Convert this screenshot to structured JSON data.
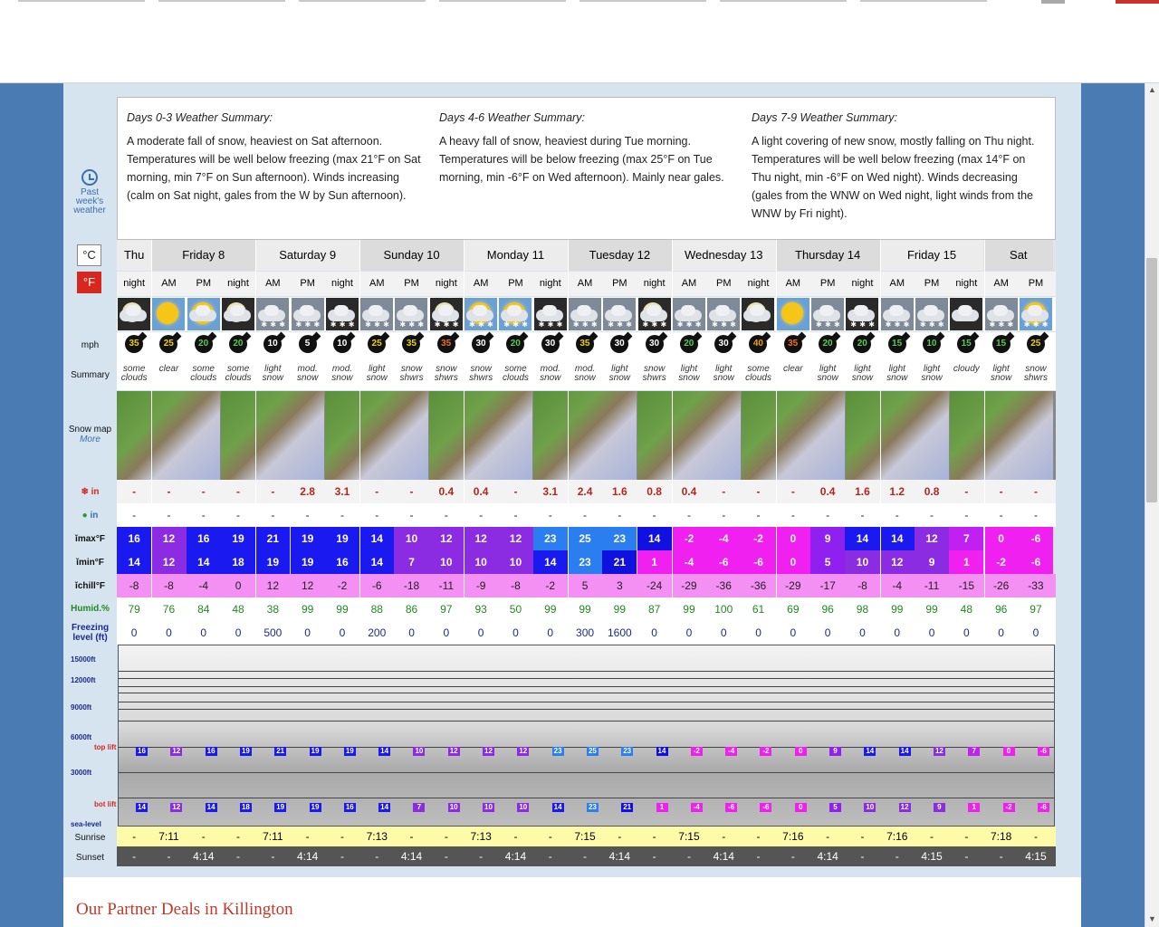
{
  "summary": [
    {
      "title": "Days 0-3 Weather Summary:",
      "text": "A moderate fall of snow, heaviest on Sat afternoon. Temperatures will be well below freezing (max 21°F on Sat morning, min 7°F on Sun afternoon). Winds increasing (calm on Sat night, gales from the W by Sun afternoon)."
    },
    {
      "title": "Days 4-6 Weather Summary:",
      "text": "A heavy fall of snow, heaviest during Tue morning. Temperatures will be below freezing (max 25°F on Tue morning, min -6°F on Wed afternoon). Mainly near gales."
    },
    {
      "title": "Days 7-9 Weather Summary:",
      "text": "A light covering of new snow, mostly falling on Thu night. Temperatures will be well below freezing (max 14°F on Thu night, min -6°F on Wed night). Winds decreasing (gales from the WNW on Wed night, light winds from the WNW by Fri night)."
    }
  ],
  "past_weather": "Past week's weather",
  "units": {
    "c": "°C",
    "f": "°F"
  },
  "labels": {
    "mph": "mph",
    "summary": "Summary",
    "snowmap": "Snow map",
    "more": "More",
    "snow": "in",
    "rain": "in",
    "max": "max°F",
    "min": "min°F",
    "chill": "chill°F",
    "humid": "Humid.%",
    "freezing": "Freezing level (ft)",
    "sunrise": "Sunrise",
    "sunset": "Sunset",
    "partner": "Our Partner Deals in Killington"
  },
  "height_labels": [
    "15000ft",
    "12000ft",
    "9000ft",
    "6000ft",
    "top lift",
    "3000ft",
    "bot lift",
    "sea-level"
  ],
  "days": [
    {
      "name": "Thu",
      "n": 1
    },
    {
      "name": "Friday 8",
      "n": 3
    },
    {
      "name": "Saturday 9",
      "n": 3
    },
    {
      "name": "Sunday 10",
      "n": 3
    },
    {
      "name": "Monday 11",
      "n": 3
    },
    {
      "name": "Tuesday 12",
      "n": 3
    },
    {
      "name": "Wednesday 13",
      "n": 3
    },
    {
      "name": "Thursday 14",
      "n": 3
    },
    {
      "name": "Friday 15",
      "n": 3
    },
    {
      "name": "Sat",
      "n": 2
    }
  ],
  "periods": [
    "night",
    "AM",
    "PM",
    "night",
    "AM",
    "PM",
    "night",
    "AM",
    "PM",
    "night",
    "AM",
    "PM",
    "night",
    "AM",
    "PM",
    "night",
    "AM",
    "PM",
    "night",
    "AM",
    "PM",
    "night",
    "AM",
    "PM",
    "night",
    "AM",
    "PM",
    "night",
    "AM",
    "PM"
  ],
  "icons": [
    "moon-cloud",
    "sun",
    "sun-cloud",
    "moon-cloud",
    "snow-cloud",
    "snow-cloud",
    "snow-night",
    "snow-cloud",
    "snow-cloud",
    "moon-snow",
    "sun-snow",
    "sun-snow",
    "snow-night",
    "snow-cloud",
    "snow-cloud",
    "moon-snow",
    "snow-cloud",
    "snow-cloud",
    "moon-cloud",
    "sun",
    "snow-cloud",
    "snow-night",
    "snow-cloud",
    "snow-cloud",
    "cloud-night",
    "snow-cloud",
    "sun-snow",
    "x",
    "x",
    "x"
  ],
  "wind": [
    "35",
    "25",
    "20",
    "20",
    "10",
    "5",
    "10",
    "25",
    "35",
    "35",
    "30",
    "20",
    "30",
    "35",
    "30",
    "30",
    "20",
    "30",
    "40",
    "35",
    "20",
    "20",
    "15",
    "10",
    "15",
    "15",
    "25"
  ],
  "wind_colors": [
    "#f0d000",
    "#f0d000",
    "#5c5",
    "#5c5",
    "#fff",
    "#fff",
    "#fff",
    "#f0d000",
    "#f0d000",
    "#f07020",
    "#fff",
    "#5c5",
    "#fff",
    "#f0d000",
    "#fff",
    "#fff",
    "#5c5",
    "#fff",
    "#f0a000",
    "#f07020",
    "#5c5",
    "#5c5",
    "#5c5",
    "#5c5",
    "#5c5",
    "#5c5",
    "#f0d000"
  ],
  "summaries": [
    "some clouds",
    "clear",
    "some clouds",
    "some clouds",
    "light snow",
    "mod. snow",
    "mod. snow",
    "light snow",
    "snow shwrs",
    "snow shwrs",
    "snow shwrs",
    "some clouds",
    "mod. snow",
    "mod. snow",
    "light snow",
    "snow shwrs",
    "light snow",
    "light snow",
    "some clouds",
    "clear",
    "light snow",
    "light snow",
    "light snow",
    "light snow",
    "cloudy",
    "light snow",
    "snow shwrs"
  ],
  "snow": [
    "-",
    "-",
    "-",
    "-",
    "-",
    "2.8",
    "3.1",
    "-",
    "-",
    "0.4",
    "0.4",
    "-",
    "3.1",
    "2.4",
    "1.6",
    "0.8",
    "0.4",
    "-",
    "-",
    "-",
    "0.4",
    "1.6",
    "1.2",
    "0.8",
    "-",
    "-",
    "-"
  ],
  "rain": [
    "-",
    "-",
    "-",
    "-",
    "-",
    "-",
    "-",
    "-",
    "-",
    "-",
    "-",
    "-",
    "-",
    "-",
    "-",
    "-",
    "-",
    "-",
    "-",
    "-",
    "-",
    "-",
    "-",
    "-",
    "-",
    "-",
    "-"
  ],
  "max": [
    "16",
    "12",
    "16",
    "19",
    "21",
    "19",
    "19",
    "14",
    "10",
    "12",
    "12",
    "12",
    "23",
    "25",
    "23",
    "14",
    "-2",
    "-4",
    "-2",
    "0",
    "9",
    "14",
    "14",
    "12",
    "7",
    "0",
    "-6"
  ],
  "min": [
    "14",
    "12",
    "14",
    "18",
    "19",
    "19",
    "16",
    "14",
    "7",
    "10",
    "10",
    "10",
    "14",
    "23",
    "21",
    "1",
    "-4",
    "-6",
    "-6",
    "0",
    "5",
    "10",
    "12",
    "9",
    "1",
    "-2",
    "-6"
  ],
  "max_colors": [
    "#1a1af0",
    "#8b2be2",
    "#1a1af0",
    "#1a1af0",
    "#1a1af0",
    "#1a1af0",
    "#1a1af0",
    "#1a1af0",
    "#8b2be2",
    "#8b2be2",
    "#8b2be2",
    "#8b2be2",
    "#2a7ef0",
    "#2a7ef0",
    "#2a7ef0",
    "#1010e0",
    "#f020f0",
    "#f020f0",
    "#f020f0",
    "#f020f0",
    "#9020f0",
    "#1a1af0",
    "#1a1af0",
    "#8b2be2",
    "#c020f0",
    "#f020f0",
    "#f020f0"
  ],
  "min_colors": [
    "#1a1af0",
    "#8b2be2",
    "#1a1af0",
    "#1a1af0",
    "#1a1af0",
    "#1a1af0",
    "#1a1af0",
    "#1a1af0",
    "#8b2be2",
    "#8b2be2",
    "#8b2be2",
    "#8b2be2",
    "#1a1af0",
    "#2a7ef0",
    "#1010e0",
    "#f020f0",
    "#f020f0",
    "#f020f0",
    "#f020f0",
    "#f020f0",
    "#9020f0",
    "#8b2be2",
    "#8b2be2",
    "#8b2be2",
    "#f020f0",
    "#f020f0",
    "#f020f0"
  ],
  "chill": [
    "-8",
    "-8",
    "-4",
    "0",
    "12",
    "12",
    "-2",
    "-6",
    "-18",
    "-11",
    "-9",
    "-8",
    "-2",
    "5",
    "3",
    "-24",
    "-29",
    "-36",
    "-36",
    "-29",
    "-17",
    "-8",
    "-4",
    "-11",
    "-15",
    "-26",
    "-33"
  ],
  "humid": [
    "79",
    "76",
    "84",
    "48",
    "38",
    "99",
    "99",
    "88",
    "86",
    "97",
    "93",
    "50",
    "99",
    "99",
    "99",
    "87",
    "99",
    "100",
    "61",
    "69",
    "96",
    "98",
    "99",
    "99",
    "48",
    "96",
    "97"
  ],
  "freezing": [
    "0",
    "0",
    "0",
    "0",
    "500",
    "0",
    "0",
    "200",
    "0",
    "0",
    "0",
    "0",
    "0",
    "300",
    "1600",
    "0",
    "0",
    "0",
    "0",
    "0",
    "0",
    "0",
    "0",
    "0",
    "0",
    "0",
    "0"
  ],
  "sunrise": [
    "-",
    "7:11",
    "-",
    "-",
    "7:11",
    "-",
    "-",
    "7:13",
    "-",
    "-",
    "7:13",
    "-",
    "-",
    "7:15",
    "-",
    "-",
    "7:15",
    "-",
    "-",
    "7:16",
    "-",
    "-",
    "7:16",
    "-",
    "-",
    "7:18",
    "-"
  ],
  "sunset": [
    "-",
    "-",
    "4:14",
    "-",
    "-",
    "4:14",
    "-",
    "-",
    "4:14",
    "-",
    "-",
    "4:14",
    "-",
    "-",
    "4:14",
    "-",
    "-",
    "4:14",
    "-",
    "-",
    "4:14",
    "-",
    "-",
    "4:15",
    "-",
    "-",
    "4:15"
  ]
}
